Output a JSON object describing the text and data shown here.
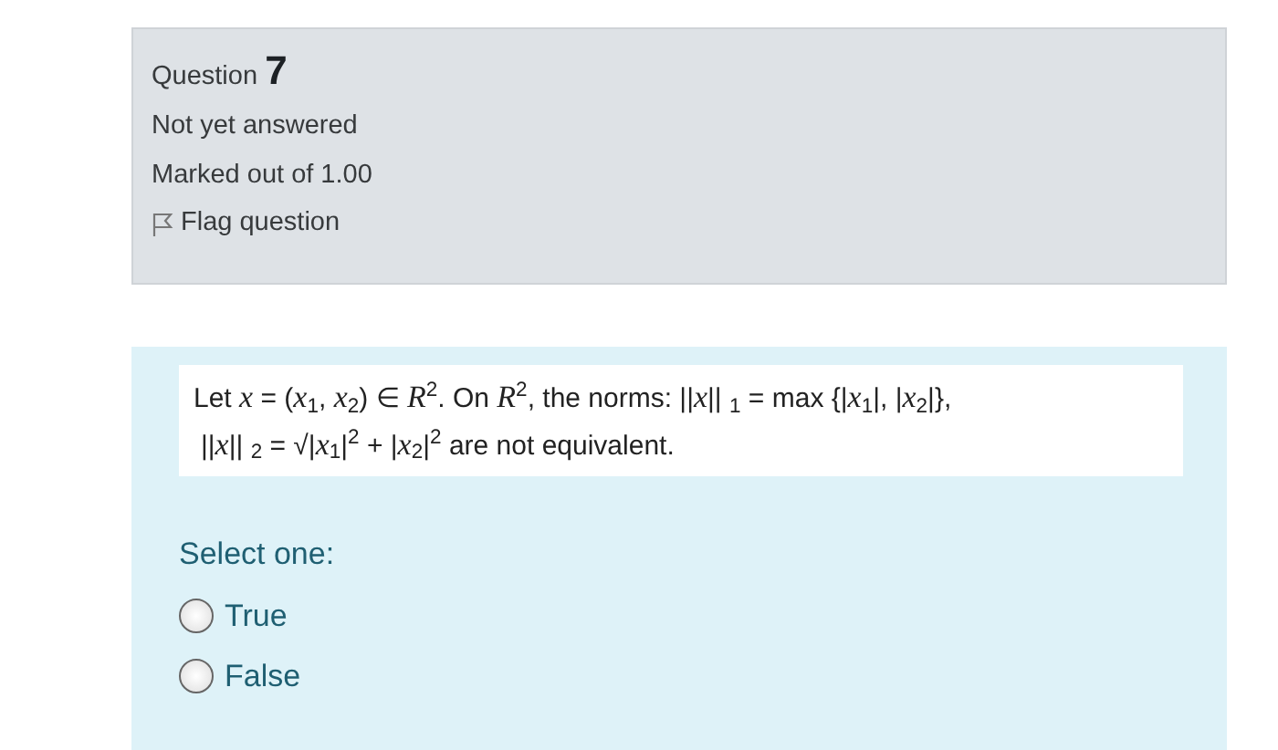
{
  "info": {
    "label": "Question",
    "number": "7",
    "status": "Not yet answered",
    "marks": "Marked out of 1.00",
    "flag": {
      "label": "Flag question",
      "flagged": false
    }
  },
  "question": {
    "lines": [
      "Let *x* = (*x*$_{1}$, *x*$_{2}$) ∈ *R*$^{2}$.  On *R*$^{2}$, the norms: ||*x*|| $_{1}$ = max {|*x*$_{1}$|, |*x*$_{2}$|},",
      "||*x*|| $_{2}$ = √|*x*$_{1}$|$^{2}$ + |*x*$_{2}$|$^{2}$  are not equivalent."
    ],
    "prompt": "Select one:",
    "options": [
      {
        "label": "True",
        "selected": false
      },
      {
        "label": "False",
        "selected": false
      }
    ]
  }
}
